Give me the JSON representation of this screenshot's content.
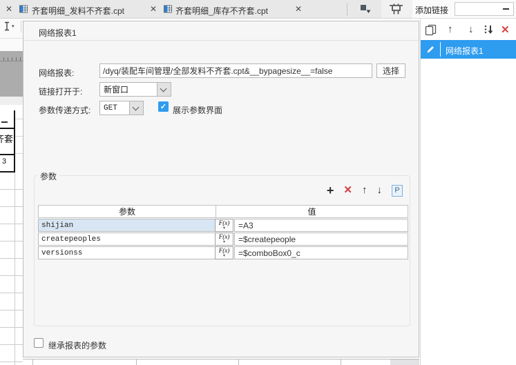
{
  "tab_bar": {
    "tabs": [
      {
        "label": "齐套明细_发料不齐套.cpt"
      },
      {
        "label": "齐套明细_库存不齐套.cpt"
      }
    ]
  },
  "link_panel": {
    "header": "添加链接",
    "item": "网络报表1"
  },
  "dialog": {
    "title": "网络报表1",
    "report_field": {
      "label": "网络报表:",
      "value": "/dyq/装配车间管理/全部发料不齐套.cpt&__bypagesize__=false",
      "choose_button": "选择"
    },
    "open_target": {
      "label": "链接打开于:",
      "value": "新窗口"
    },
    "param_method": {
      "label": "参数传递方式:",
      "value": "GET",
      "checkbox_label": "展示参数界面",
      "checked": true
    },
    "params": {
      "group_title": "参数",
      "p_button": "P",
      "fx_button": "F(x)",
      "columns": {
        "param": "参数",
        "value": "值"
      },
      "rows": [
        {
          "name": "shijian",
          "value": "=A3"
        },
        {
          "name": "createpeoples",
          "value": "=$createpeople"
        },
        {
          "name": "versionss",
          "value": "=$comboBox0_c"
        }
      ]
    },
    "inherit_checkbox": {
      "label": "继承报表的参数",
      "checked": false
    }
  },
  "worksheet_fragment": {
    "cell_a": "齐套",
    "cell_b": "3"
  },
  "icons": {
    "close": "✕",
    "plus": "+",
    "delete": "✕",
    "up": "↑",
    "down": "↓",
    "check": "✓",
    "fx_caret": "▾"
  },
  "colors": {
    "accent": "#2E9CEF",
    "danger": "#D43C3C",
    "selected_row": "#D8E6F4"
  }
}
